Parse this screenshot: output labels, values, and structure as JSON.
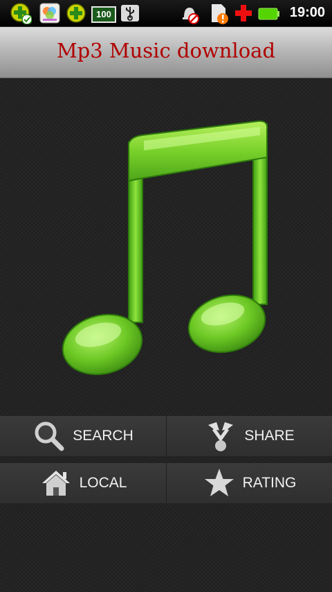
{
  "status_bar": {
    "time": "19:00",
    "battery_level_label": "100",
    "icons": [
      "add-icon",
      "check-icon",
      "gallery-app-icon",
      "add-icon",
      "battery-100-icon",
      "usb-icon",
      "alarm-off-icon",
      "sd-card-warning-icon",
      "red-cross-icon",
      "battery-icon"
    ]
  },
  "header": {
    "title": "Mp3 Music download"
  },
  "menu": {
    "search_label": "SEARCH",
    "share_label": "SHARE",
    "local_label": "LOCAL",
    "rating_label": "RATING"
  },
  "colors": {
    "title_red": "#b00000",
    "note_green": "#6fcf2a",
    "button_bg": "#3a3a3a"
  }
}
